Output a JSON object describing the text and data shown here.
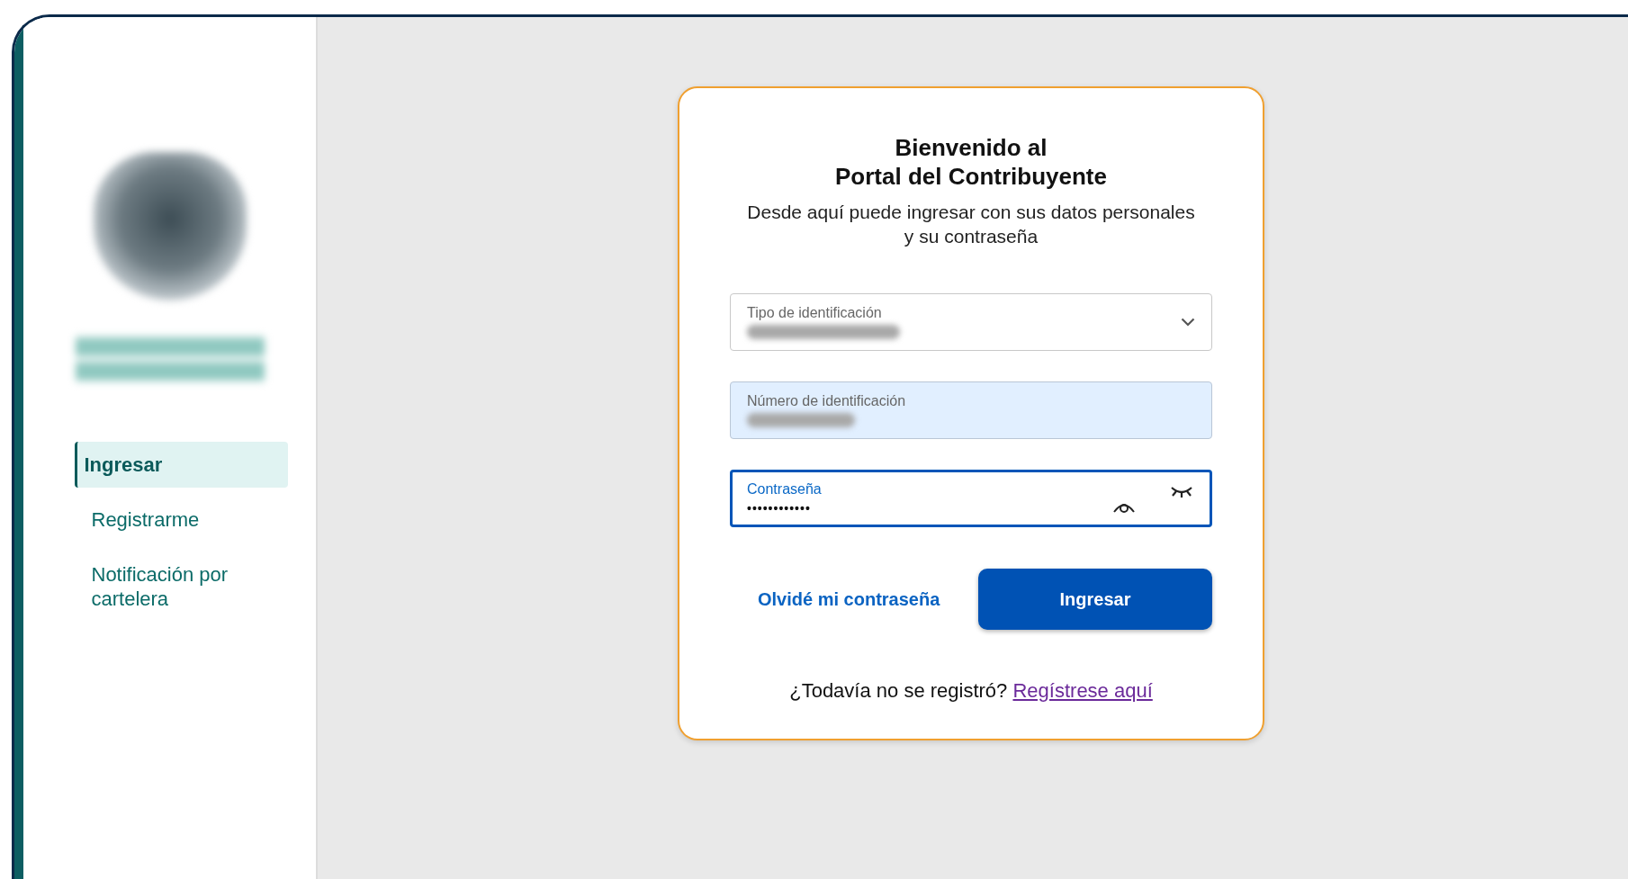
{
  "sidebar": {
    "items": [
      {
        "label": "Ingresar",
        "selected": true
      },
      {
        "label": "Registrarme",
        "selected": false
      },
      {
        "label": "Notificación por cartelera",
        "selected": false
      }
    ]
  },
  "login_card": {
    "title_lines": [
      "Bienvenido al",
      "Portal del Contribuyente"
    ],
    "subtitle": "Desde aquí puede ingresar con sus datos personales y su contraseña",
    "fields": [
      {
        "kind": "select",
        "label": "Tipo de identificación",
        "autofilled": false,
        "focused": false
      },
      {
        "kind": "text",
        "label": "Número de identificación",
        "autofilled": true,
        "focused": false
      },
      {
        "kind": "password",
        "label": "Contraseña",
        "value": "••••••••••••",
        "autofilled": false,
        "focused": true
      }
    ],
    "forgot_link": "Olvidé mi contraseña",
    "submit_button": "Ingresar",
    "register_prompt": "¿Todavía no se registró?",
    "register_link": "Regístrese aquí"
  }
}
